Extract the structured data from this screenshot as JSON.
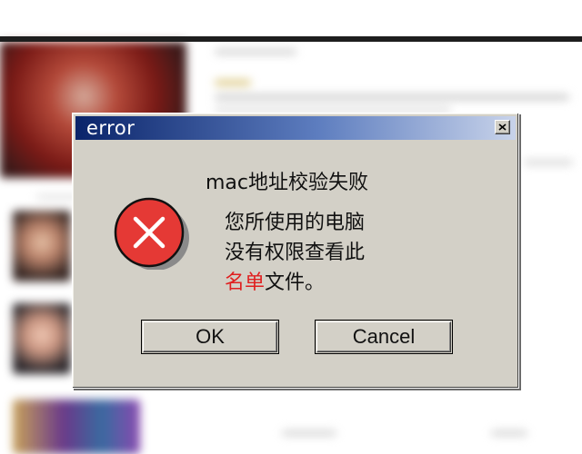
{
  "dialog": {
    "title": "error",
    "message_title": "mac地址校验失败",
    "message_line1": "您所使用的电脑",
    "message_line2": "没有权限查看此",
    "message_line3_red": "名单",
    "message_line3_rest": "文件。",
    "ok_label": "OK",
    "cancel_label": "Cancel"
  },
  "icons": {
    "error": "error-x-icon",
    "close": "close-icon"
  },
  "colors": {
    "titlebar_start": "#0a246a",
    "titlebar_end": "#c8d3ea",
    "dialog_bg": "#d3d0c7",
    "error_red": "#e53935",
    "highlight_red": "#e02020"
  }
}
